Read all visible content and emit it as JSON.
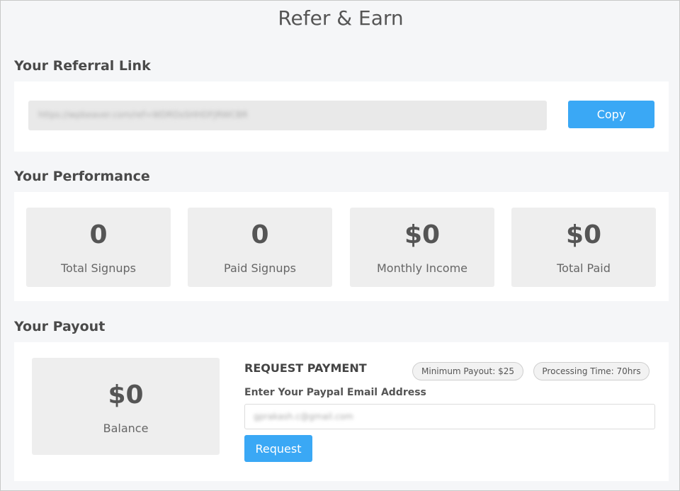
{
  "page": {
    "title": "Refer & Earn"
  },
  "referral": {
    "section_title": "Your Referral Link",
    "link_value": "https://wpbeaver.com/ref=WDRDsSHHDFJRWCBR",
    "copy_label": "Copy"
  },
  "performance": {
    "section_title": "Your Performance",
    "stats": [
      {
        "value": "0",
        "label": "Total Signups"
      },
      {
        "value": "0",
        "label": "Paid Signups"
      },
      {
        "value": "$0",
        "label": "Monthly Income"
      },
      {
        "value": "$0",
        "label": "Total Paid"
      }
    ]
  },
  "payout": {
    "section_title": "Your Payout",
    "balance_value": "$0",
    "balance_label": "Balance",
    "request_title": "REQUEST PAYMENT",
    "minimum_payout": "Minimum Payout: $25",
    "processing_time": "Processing Time: 70hrs",
    "email_label": "Enter Your Paypal Email Address",
    "email_value": "gprakash.c@gmail.com",
    "request_label": "Request"
  },
  "colors": {
    "accent": "#3aa8f5",
    "page_bg": "#f5f6f8",
    "card_bg": "#ffffff",
    "stat_bg": "#eeeeee"
  }
}
